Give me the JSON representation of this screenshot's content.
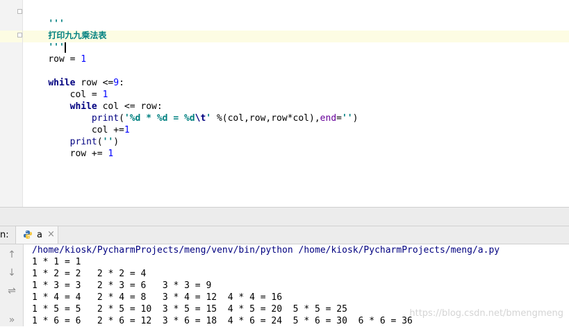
{
  "editor": {
    "lines": [
      {
        "doc": "'''"
      },
      {
        "cn": "打印九九乘法表"
      },
      {
        "doc": "'''"
      },
      {
        "a": "row = ",
        "b": "1"
      },
      {},
      {
        "kw": "while",
        "a": " row <=",
        "b": "9",
        "c": ":"
      },
      {
        "a": "    col = ",
        "b": "1"
      },
      {
        "kw": "    while",
        "a": " col <= row:"
      },
      {
        "builtin": "        print",
        "p1": "(",
        "str1": "'%d * %d = %d",
        "esc": "\\t",
        "str2": "'",
        "p2": " %(col,row,row*col),",
        "kwarg": "end",
        "p3": "=",
        "str3": "''",
        "p4": ")"
      },
      {
        "a": "        col +=",
        "b": "1"
      },
      {
        "builtin": "    print",
        "p1": "(",
        "str1": "''",
        "p2": ")"
      },
      {
        "a": "    row += ",
        "b": "1"
      }
    ]
  },
  "run": {
    "prefix": "n:",
    "tab_label": "a",
    "tab_close": "×",
    "tools": {
      "up": "↑",
      "down": "↓",
      "wrap": "⇌",
      "more": "»"
    }
  },
  "console": {
    "command": "/home/kiosk/PycharmProjects/meng/venv/bin/python /home/kiosk/PycharmProjects/meng/a.py",
    "output": [
      "1 * 1 = 1",
      "1 * 2 = 2   2 * 2 = 4",
      "1 * 3 = 3   2 * 3 = 6   3 * 3 = 9",
      "1 * 4 = 4   2 * 4 = 8   3 * 4 = 12  4 * 4 = 16",
      "1 * 5 = 5   2 * 5 = 10  3 * 5 = 15  4 * 5 = 20  5 * 5 = 25",
      "1 * 6 = 6   2 * 6 = 12  3 * 6 = 18  4 * 6 = 24  5 * 6 = 30  6 * 6 = 36"
    ]
  },
  "watermark": "https://blog.csdn.net/bmengmeng"
}
